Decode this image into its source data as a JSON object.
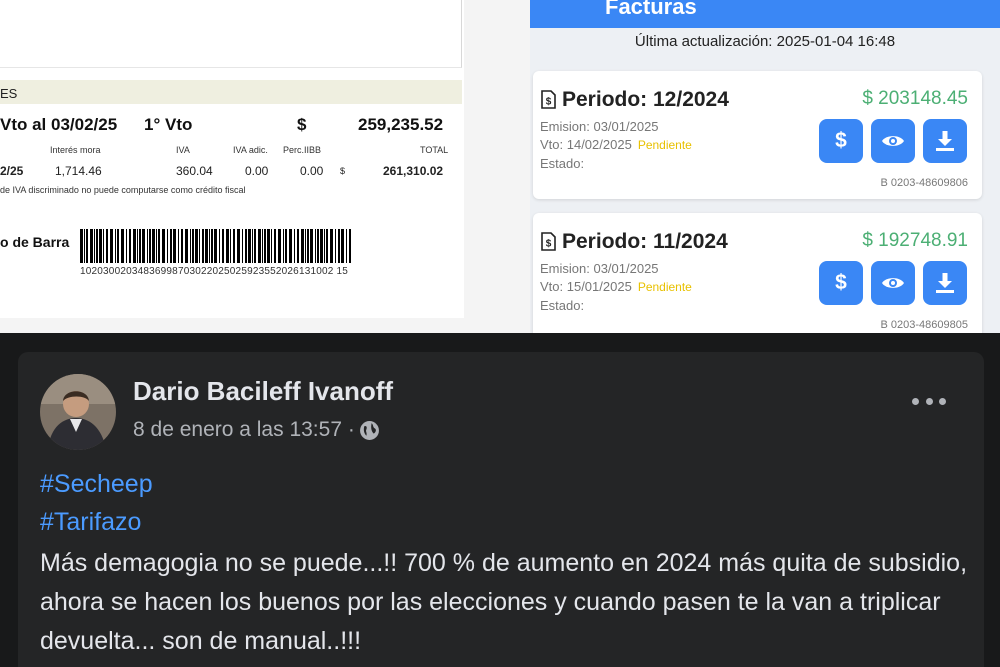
{
  "invoice": {
    "section_label": "ES",
    "vto_label": "Vto al 03/02/25",
    "vto_number": "1° Vto",
    "currency": "$",
    "total_first": "259,235.52",
    "columns": [
      "Interés mora",
      "IVA",
      "IVA adic.",
      "Perc.IIBB",
      "TOTAL"
    ],
    "date_fragment": "2/25",
    "interes_mora": "1,714.46",
    "iva": "360.04",
    "iva_adic": "0.00",
    "perc_iibb": "0.00",
    "currency_small": "$",
    "total": "261,310.02",
    "note": "de IVA discriminado no puede computarse como crédito fiscal",
    "barcode_label": "o de Barra",
    "barcode_number": "10203002034836998703022025025923552026131002 15"
  },
  "app": {
    "title": "Facturas",
    "last_update": "Última actualización: 2025-01-04 16:48",
    "bills": [
      {
        "period": "Periodo: 12/2024",
        "amount": "$ 203148.45",
        "emision": "Emision: 03/01/2025",
        "vto": "Vto: 14/02/2025",
        "status": "Pendiente",
        "estado": "Estado:",
        "ref": "B 0203-48609806",
        "pay_symbol": "$"
      },
      {
        "period": "Periodo: 11/2024",
        "amount": "$ 192748.91",
        "emision": "Emision: 03/01/2025",
        "vto": "Vto: 15/01/2025",
        "status": "Pendiente",
        "estado": "Estado:",
        "ref": "B 0203-48609805",
        "pay_symbol": "$"
      }
    ],
    "colors": {
      "primary": "#3a87f5",
      "amount": "#4caf74",
      "pending": "#e8c100"
    }
  },
  "post": {
    "author": "Dario Bacileff Ivanoff",
    "timestamp": "8 de enero a las 13:57 ·",
    "hashtags": [
      "#Secheep",
      "#Tarifazo"
    ],
    "text": "Más demagogia no se puede...!! 700 % de aumento en 2024 más quita de subsidio, ahora se hacen los buenos por las elecciones y cuando pasen te la van a triplicar devuelta... son de manual..!!!",
    "colors": {
      "background": "#242526",
      "text": "#e4e6eb",
      "hashtag": "#4b9bff"
    }
  }
}
